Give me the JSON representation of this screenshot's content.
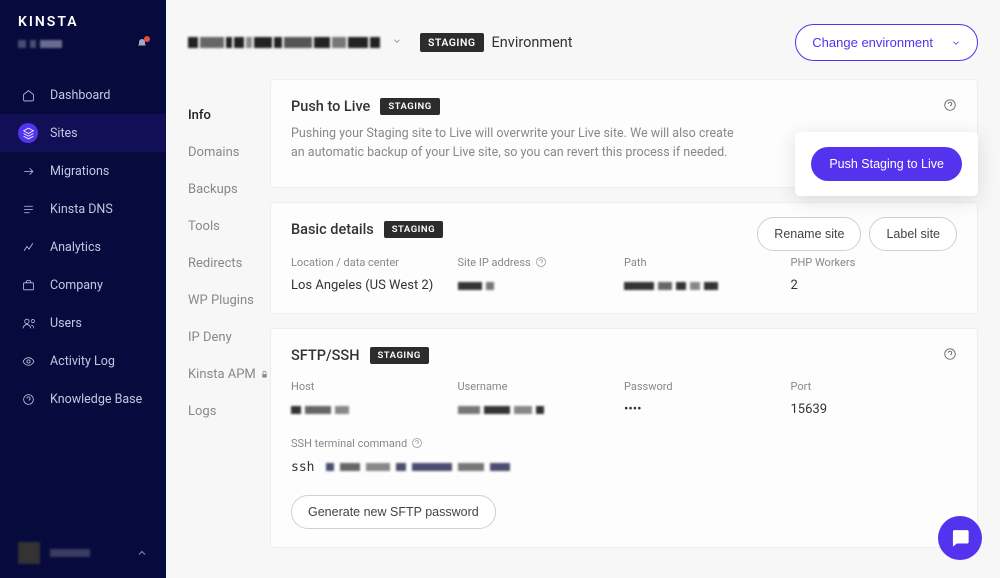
{
  "brand": "KINSTA",
  "nav": {
    "dashboard": "Dashboard",
    "sites": "Sites",
    "migrations": "Migrations",
    "dns": "Kinsta DNS",
    "analytics": "Analytics",
    "company": "Company",
    "users": "Users",
    "activity": "Activity Log",
    "knowledge": "Knowledge Base"
  },
  "header": {
    "env_badge": "STAGING",
    "env_label": "Environment",
    "change_env": "Change environment"
  },
  "subnav": {
    "info": "Info",
    "domains": "Domains",
    "backups": "Backups",
    "tools": "Tools",
    "redirects": "Redirects",
    "plugins": "WP Plugins",
    "ipdeny": "IP Deny",
    "apm": "Kinsta APM",
    "logs": "Logs"
  },
  "push": {
    "title": "Push to Live",
    "badge": "STAGING",
    "desc": "Pushing your Staging site to Live will overwrite your Live site. We will also create an automatic backup of your Live site, so you can revert this process if needed.",
    "button": "Push Staging to Live"
  },
  "basic": {
    "title": "Basic details",
    "badge": "STAGING",
    "rename": "Rename site",
    "label_site": "Label site",
    "loc_label": "Location / data center",
    "loc_value": "Los Angeles (US West 2)",
    "ip_label": "Site IP address",
    "path_label": "Path",
    "workers_label": "PHP Workers",
    "workers_value": "2"
  },
  "sftp": {
    "title": "SFTP/SSH",
    "badge": "STAGING",
    "host_label": "Host",
    "user_label": "Username",
    "pass_label": "Password",
    "pass_value": "••••",
    "port_label": "Port",
    "port_value": "15639",
    "ssh_label": "SSH terminal command",
    "ssh_prefix": "ssh",
    "gen_button": "Generate new SFTP password"
  }
}
